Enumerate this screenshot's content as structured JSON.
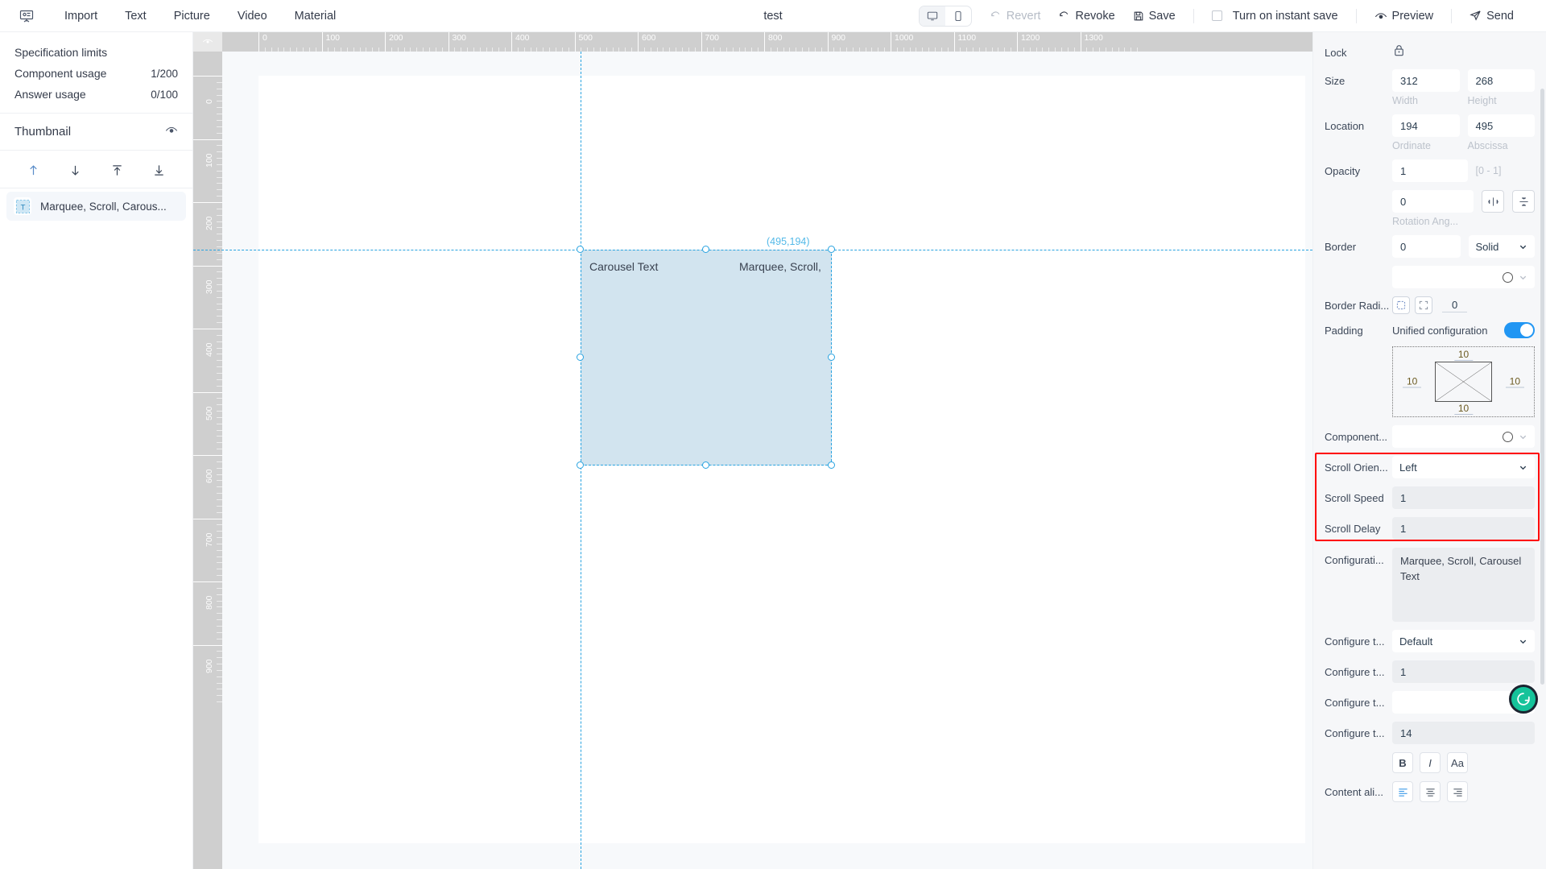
{
  "topbar": {
    "logo_icon": "presentation-icon",
    "menu": [
      {
        "label": "Import"
      },
      {
        "label": "Text"
      },
      {
        "label": "Picture"
      },
      {
        "label": "Video"
      },
      {
        "label": "Material"
      }
    ],
    "title": "test",
    "device_toggle": [
      {
        "icon": "monitor-icon",
        "selected": true
      },
      {
        "icon": "phone-icon",
        "selected": false
      }
    ],
    "revert_label": "Revert",
    "revoke_label": "Revoke",
    "save_label": "Save",
    "instant_save_label": "Turn on instant save",
    "instant_save_checked": false,
    "preview_label": "Preview",
    "send_label": "Send"
  },
  "leftpanel": {
    "spec_limits_label": "Specification limits",
    "component_usage_label": "Component usage",
    "component_usage_value": "1/200",
    "answer_usage_label": "Answer usage",
    "answer_usage_value": "0/100",
    "thumbnail_label": "Thumbnail",
    "thumbnail_icon": "eye-icon",
    "tools": [
      {
        "icon": "arrow-up-icon",
        "active": true
      },
      {
        "icon": "arrow-down-icon",
        "active": false
      },
      {
        "icon": "move-to-top-icon",
        "active": false
      },
      {
        "icon": "move-to-bottom-icon",
        "active": false
      }
    ],
    "layers": [
      {
        "icon": "text-layer-icon",
        "label": "Marquee, Scroll, Carous..."
      }
    ]
  },
  "canvas": {
    "ruler_h_labels": [
      "0",
      "100",
      "200",
      "300",
      "400",
      "500",
      "600",
      "700",
      "800",
      "900",
      "1000",
      "1100",
      "1200",
      "1300"
    ],
    "ruler_v_labels": [
      "0",
      "100",
      "200",
      "300",
      "400",
      "500",
      "600",
      "700",
      "800",
      "900"
    ],
    "coord_label": "(495,194)",
    "selection": {
      "text_left": "Carousel  Text",
      "text_right": "Marquee, Scroll,"
    }
  },
  "rightpanel": {
    "lock_label": "Lock",
    "lock_icon": "lock-icon",
    "size_label": "Size",
    "size_width": "312",
    "size_height": "268",
    "width_hint": "Width",
    "height_hint": "Height",
    "location_label": "Location",
    "location_ordinate": "194",
    "location_abscissa": "495",
    "ordinate_hint": "Ordinate",
    "abscissa_hint": "Abscissa",
    "opacity_label": "Opacity",
    "opacity_value": "1",
    "opacity_hint": "[0 - 1]",
    "rotation_value": "0",
    "rotation_hint": "Rotation Ang...",
    "flip_h_icon": "flip-horizontal-icon",
    "flip_v_icon": "flip-vertical-icon",
    "border_label": "Border",
    "border_width": "0",
    "border_style": "Solid",
    "border_color_icon": "color-circle-icon",
    "border_radius_label": "Border Radi...",
    "border_radius_value": "0",
    "radius_all_icon": "radius-all-icon",
    "radius_corner_icon": "radius-corner-icon",
    "padding_label": "Padding",
    "unified_config_label": "Unified configuration",
    "unified_config_on": true,
    "padding_top": "10",
    "padding_right": "10",
    "padding_bottom": "10",
    "padding_left": "10",
    "component_label": "Component...",
    "component_color_icon": "color-circle-icon",
    "scroll_orientation_label": "Scroll Orien...",
    "scroll_orientation_value": "Left",
    "scroll_speed_label": "Scroll Speed",
    "scroll_speed_value": "1",
    "scroll_delay_label": "Scroll Delay",
    "scroll_delay_value": "1",
    "configuration_label": "Configurati...",
    "configuration_value": "Marquee, Scroll, Carousel Text",
    "configure_style_label": "Configure t...",
    "configure_style_value": "Default",
    "configure_num_label": "Configure t...",
    "configure_num_value": "1",
    "configure_empty_label": "Configure t...",
    "configure_empty_value": "",
    "configure_size_label": "Configure t...",
    "configure_size_value": "14",
    "bold_label": "B",
    "italic_label": "I",
    "case_label": "Aa",
    "content_align_label": "Content ali...",
    "align_options": [
      {
        "icon": "align-left-icon",
        "active": true
      },
      {
        "icon": "align-center-icon",
        "active": false
      },
      {
        "icon": "align-right-icon",
        "active": false
      }
    ],
    "highlight_color": "#ff0000",
    "accent_color": "#2196f3",
    "grammarly_icon": "grammarly-icon"
  }
}
